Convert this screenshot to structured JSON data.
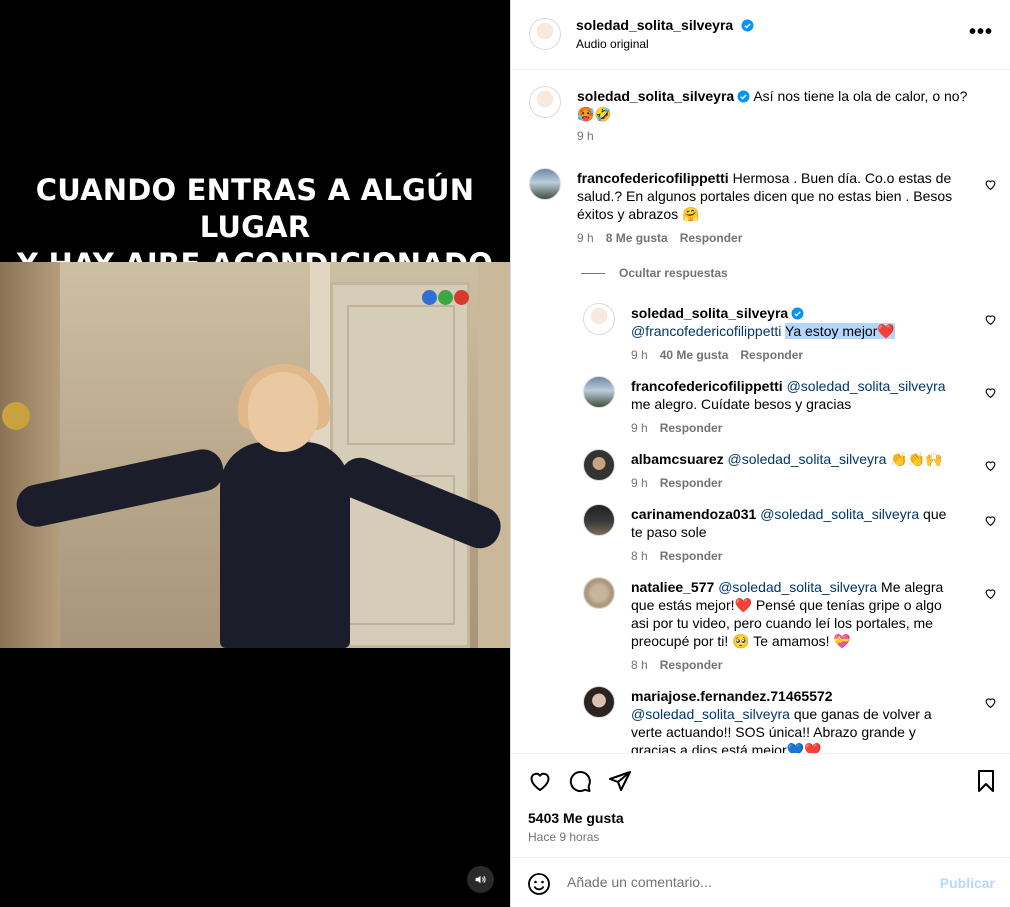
{
  "video": {
    "caption_line1": "CUANDO ENTRAS A ALGÚN LUGAR",
    "caption_line2": "Y HAY AIRE ACONDICIONADO"
  },
  "header": {
    "username": "soledad_solita_silveyra",
    "subtitle": "Audio original",
    "more": "•••"
  },
  "post": {
    "username": "soledad_solita_silveyra",
    "text": "Así nos tiene la ola de calor, o no?",
    "emoji": "🥵🤣",
    "time": "9 h"
  },
  "comments": [
    {
      "username": "francofedericofilippetti",
      "line1": "Hermosa . Buen día. Co.o estas de",
      "line2": "salud.? En algunos portales dicen que no estas bien . Besos",
      "line3": "éxitos y abrazos 🤗",
      "time": "9 h",
      "likes": "8 Me gusta",
      "reply": "Responder"
    }
  ],
  "hide_replies": "Ocultar respuestas",
  "replies": [
    {
      "username": "soledad_solita_silveyra",
      "mention": "@francofedericofilippetti",
      "text": "Ya estoy mejor❤️",
      "time": "9 h",
      "likes": "40 Me gusta",
      "reply": "Responder"
    },
    {
      "username": "francofedericofilippetti",
      "mention": "@soledad_solita_silveyra",
      "text": "me alegro. Cuídate besos y gracias",
      "time": "9 h",
      "reply": "Responder"
    },
    {
      "username": "albamcsuarez",
      "mention": "@soledad_solita_silveyra",
      "text": "👏👏🙌",
      "time": "9 h",
      "reply": "Responder"
    },
    {
      "username": "carinamendoza031",
      "mention": "@soledad_solita_silveyra",
      "text_a": "que",
      "text_b": "te paso sole",
      "time": "8 h",
      "reply": "Responder"
    },
    {
      "username": "nataliee_577",
      "mention": "@soledad_solita_silveyra",
      "text_a": "Me alegra",
      "line2": "que estás mejor!❤️ Pensé que tenías gripe o algo",
      "line3": "asi por tu video, pero cuando leí los portales, me",
      "line4": "preocupé por ti! 🥺 Te amamos! 💝",
      "time": "8 h",
      "reply": "Responder"
    },
    {
      "username": "mariajose.fernandez.71465572",
      "mention": "@soledad_solita_silveyra",
      "text_a": "que ganas de volver a",
      "line3": "verte actuando!! SOS única!! Abrazo grande y",
      "line4": "gracias a dios está mejor💙❤️"
    }
  ],
  "footer": {
    "likes": "5403 Me gusta",
    "ago": "Hace 9 horas",
    "comment_placeholder": "Añade un comentario...",
    "post_button": "Publicar"
  },
  "colors": {
    "verified": "#0095f6",
    "secondary_text": "#737373",
    "mention": "#00376b",
    "highlight": "#b4d5fe",
    "publish_disabled": "#b3dbff"
  }
}
